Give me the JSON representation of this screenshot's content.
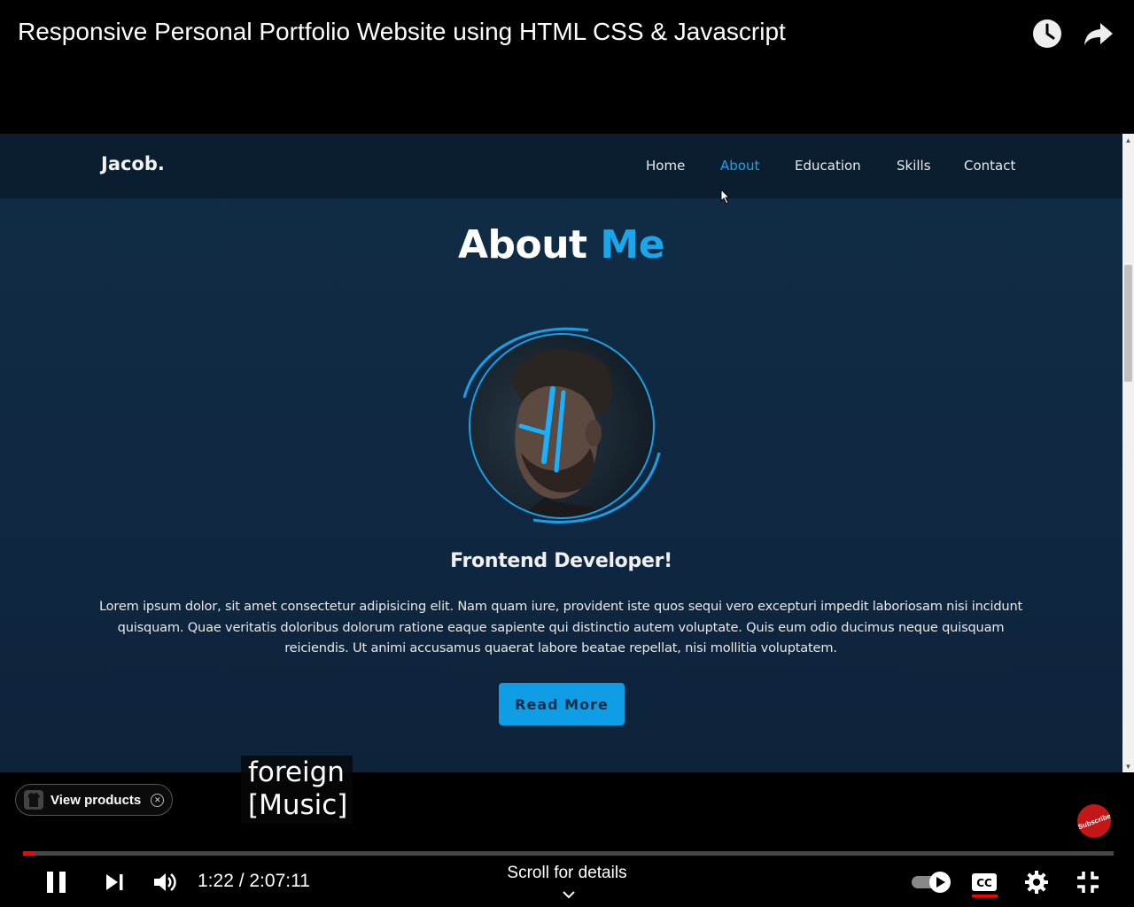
{
  "video": {
    "title": "Responsive Personal Portfolio Website using HTML CSS & Javascript"
  },
  "site": {
    "logo": "Jacob.",
    "nav": [
      "Home",
      "About",
      "Education",
      "Skills",
      "Contact"
    ],
    "active_nav": "About",
    "heading_main": "About",
    "heading_accent": "Me",
    "subheading": "Frontend Developer!",
    "paragraph": "Lorem ipsum dolor, sit amet consectetur adipisicing elit. Nam quam iure, provident iste quos sequi vero excepturi impedit laboriosam nisi incidunt quisquam. Quae veritatis doloribus dolorum ratione eaque sapiente qui distinctio autem voluptate. Quis eum odio ducimus neque quisquam reiciendis. Ut animi accusamus quaerat labore beatae repellat, nisi mollitia voluptatem.",
    "button": "Read More",
    "accent_color": "#19a6ea"
  },
  "player": {
    "chip_label": "View products",
    "captions_line1": "foreign",
    "captions_line2": "[Music]",
    "time": "1:22 / 2:07:11",
    "scroll_hint": "Scroll for details",
    "progress_fraction": 0.011,
    "badge_text": "Subscribe",
    "icons": [
      "watch-later-icon",
      "share-icon",
      "pause-icon",
      "next-icon",
      "volume-icon",
      "autoplay-toggle-icon",
      "cc-icon",
      "settings-icon",
      "exit-fullscreen-icon"
    ]
  }
}
